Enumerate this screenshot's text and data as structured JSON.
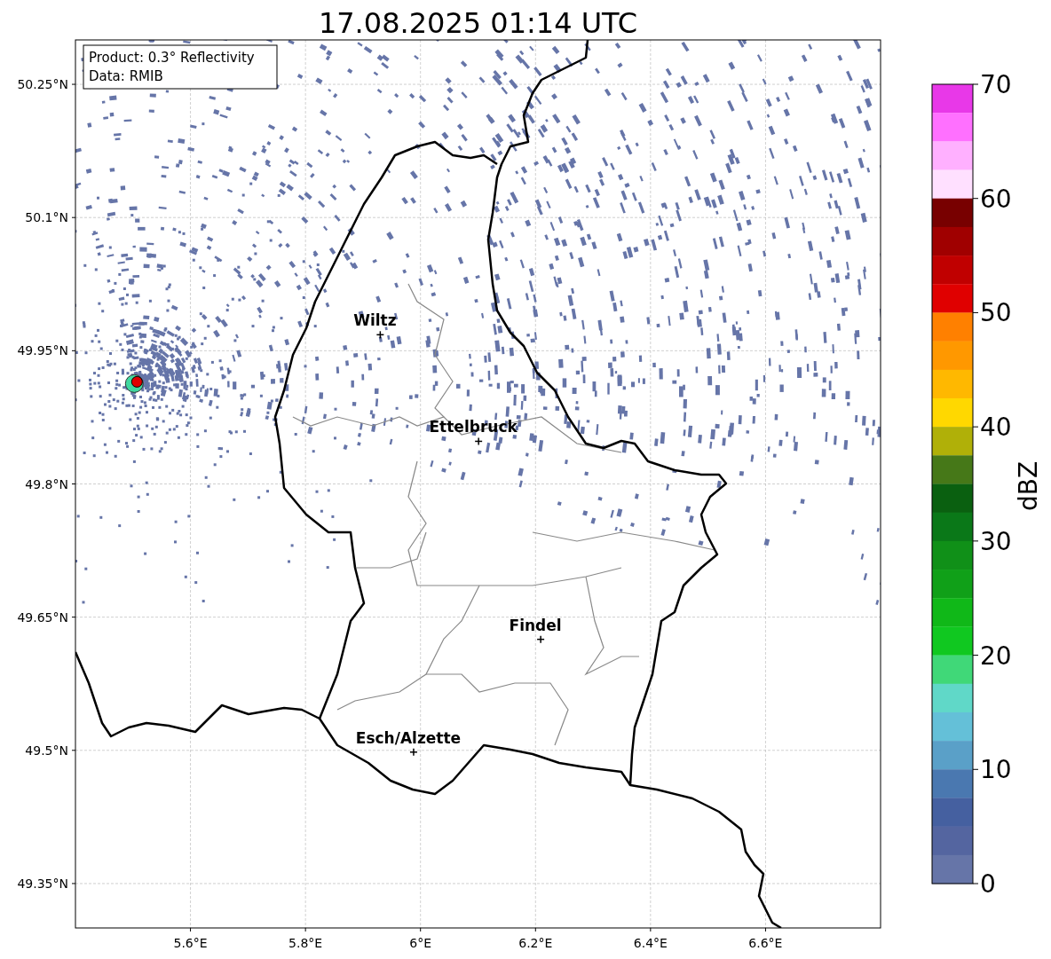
{
  "map": {
    "title": "17.08.2025 01:14 UTC",
    "info": [
      "Product: 0.3° Reflectivity",
      "Data: RMIB"
    ],
    "yticks": [
      "50.25°N",
      "50.1°N",
      "49.95°N",
      "49.8°N",
      "49.65°N",
      "49.5°N",
      "49.35°N"
    ],
    "xticks": [
      "5.6°E",
      "5.8°E",
      "6°E",
      "6.2°E",
      "6.4°E",
      "6.6°E"
    ],
    "cities": [
      "Wiltz",
      "Ettelbruck",
      "Findel",
      "Esch/Alzette"
    ]
  },
  "colorbar": {
    "label": "dBZ",
    "ticks": [
      "70",
      "60",
      "50",
      "40",
      "30",
      "20",
      "10",
      "0"
    ],
    "bands": [
      {
        "color": "#e838e8"
      },
      {
        "color": "#ff70ff"
      },
      {
        "color": "#ffb0ff"
      },
      {
        "color": "#ffe0ff"
      },
      {
        "color": "#780000"
      },
      {
        "color": "#a00000"
      },
      {
        "color": "#c00000"
      },
      {
        "color": "#e00000"
      },
      {
        "color": "#ff8000"
      },
      {
        "color": "#ff9800"
      },
      {
        "color": "#ffb800"
      },
      {
        "color": "#ffd800"
      },
      {
        "color": "#b0b008"
      },
      {
        "color": "#467818"
      },
      {
        "color": "#0a6010"
      },
      {
        "color": "#0a7818"
      },
      {
        "color": "#109018"
      },
      {
        "color": "#10a018"
      },
      {
        "color": "#10b818"
      },
      {
        "color": "#10c820"
      },
      {
        "color": "#40d878"
      },
      {
        "color": "#60d8c8"
      },
      {
        "color": "#64c0d8"
      },
      {
        "color": "#5aa0c8"
      },
      {
        "color": "#4a78b0"
      },
      {
        "color": "#4560a0"
      },
      {
        "color": "#5465a0"
      },
      {
        "color": "#6675a8"
      }
    ]
  }
}
